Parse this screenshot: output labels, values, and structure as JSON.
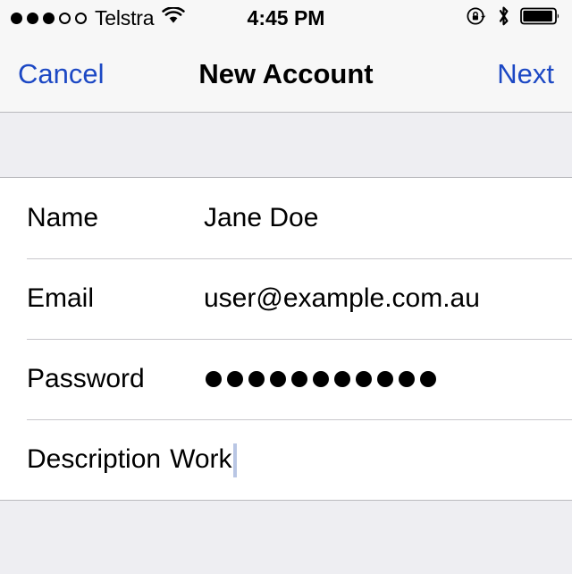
{
  "status_bar": {
    "signal": {
      "total_dots": 5,
      "filled_dots": 3
    },
    "carrier": "Telstra",
    "wifi_icon": "wifi-icon",
    "time": "4:45 PM",
    "rotation_lock_icon": "rotation-lock-icon",
    "bluetooth_icon": "bluetooth-icon",
    "battery": {
      "icon": "battery-icon",
      "level_percent": 92
    }
  },
  "nav_bar": {
    "cancel_label": "Cancel",
    "title": "New Account",
    "next_label": "Next",
    "tint_color": "#1c48c4"
  },
  "form": {
    "rows": [
      {
        "label": "Name",
        "value": "Jane Doe",
        "type": "text"
      },
      {
        "label": "Email",
        "value": "user@example.com.au",
        "type": "email"
      },
      {
        "label": "Password",
        "value": "",
        "type": "password",
        "dot_count": 11
      },
      {
        "label": "Description",
        "value": "Work",
        "type": "text",
        "focused": true
      }
    ]
  },
  "colors": {
    "bar_background": "#f7f7f7",
    "group_background": "#eeeef2",
    "separator": "#c8c7cc",
    "text": "#000000",
    "caret": "#b9c6e4"
  }
}
